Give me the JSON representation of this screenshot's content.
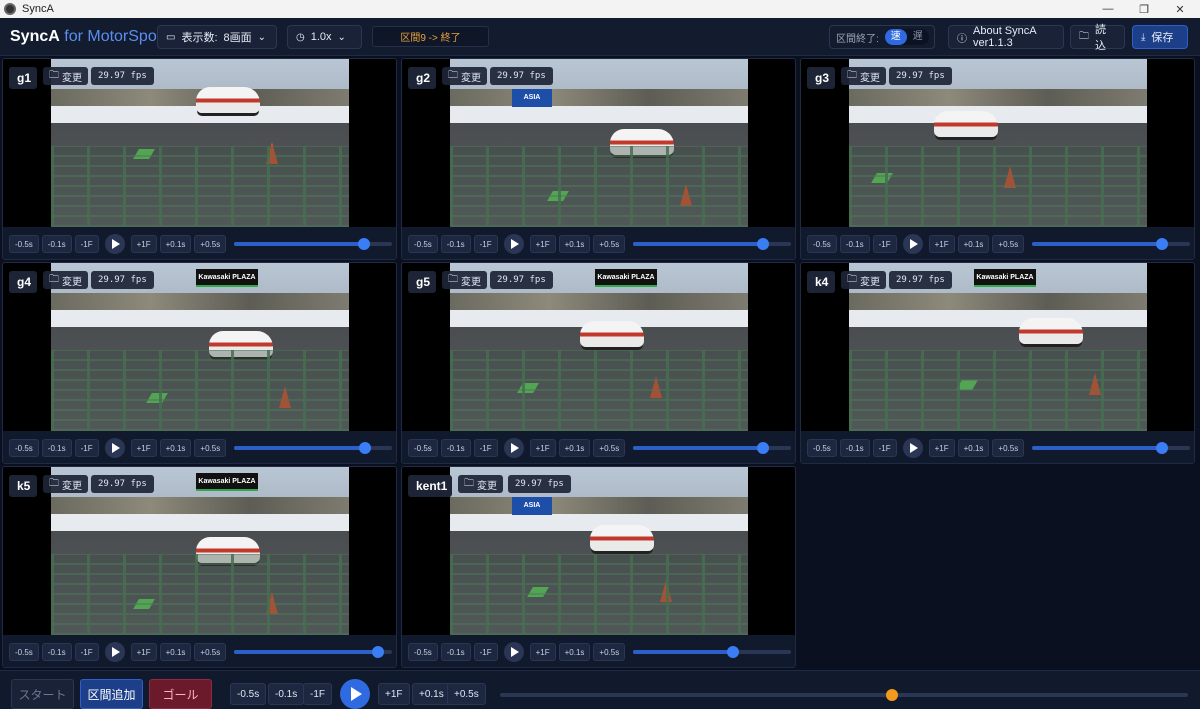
{
  "window": {
    "title": "SyncA",
    "minimize": "—",
    "maximize": "❐",
    "close": "✕"
  },
  "toolbar": {
    "brand_main": "SyncA",
    "brand_sub": " for MotorSports",
    "display_count_label": "表示数:",
    "display_count_value": "8画面",
    "speed_value": "1.0x",
    "section_status": "区間9 -> 終了",
    "section_end_label": "区間終了:",
    "toggle_fast": "速",
    "toggle_slow": "遅",
    "about": "About SyncA ver1.1.3",
    "load": "読込",
    "save": "保存"
  },
  "cameras": [
    {
      "label": "g1",
      "change": "変更",
      "fps": "29.97 fps",
      "progress": 0.82
    },
    {
      "label": "g2",
      "change": "変更",
      "fps": "29.97 fps",
      "progress": 0.82
    },
    {
      "label": "g3",
      "change": "変更",
      "fps": "29.97 fps",
      "progress": 0.82
    },
    {
      "label": "g4",
      "change": "変更",
      "fps": "29.97 fps",
      "progress": 0.83
    },
    {
      "label": "g5",
      "change": "変更",
      "fps": "29.97 fps",
      "progress": 0.82
    },
    {
      "label": "k4",
      "change": "変更",
      "fps": "29.97 fps",
      "progress": 0.82
    },
    {
      "label": "k5",
      "change": "変更",
      "fps": "29.97 fps",
      "progress": 0.91
    },
    {
      "label": "kent1",
      "change": "変更",
      "fps": "29.97 fps",
      "progress": 0.63
    }
  ],
  "step_buttons": {
    "m05": "-0.5s",
    "m01": "-0.1s",
    "m1f": "-1F",
    "p1f": "+1F",
    "p01": "+0.1s",
    "p05": "+0.5s"
  },
  "video_text": {
    "sign_kawasaki": "Kawasaki",
    "sign_plaza": "PLAZA",
    "sign_asia": "ASIA"
  },
  "bottom": {
    "start": "スタート",
    "add_section": "区間追加",
    "goal": "ゴール",
    "progress": 0.57
  },
  "colors": {
    "accent": "#2f6ae0",
    "goal": "#6b1a2c",
    "status": "#e9a23b",
    "main_knob": "#f29a1b"
  }
}
